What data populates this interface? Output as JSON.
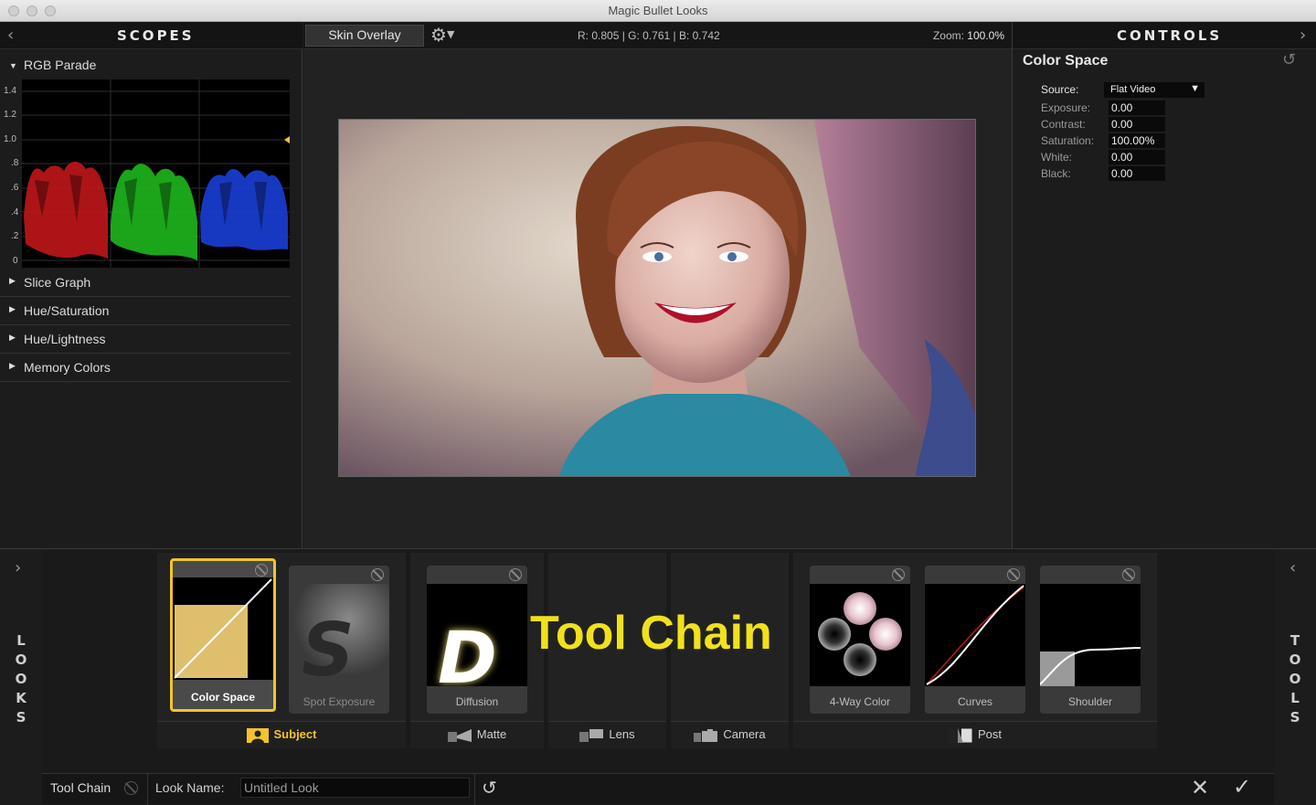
{
  "window": {
    "title": "Magic Bullet Looks"
  },
  "scopes": {
    "title": "SCOPES",
    "rgb_parade": {
      "label": "RGB Parade",
      "y_ticks": [
        "1.4",
        "1.2",
        "1.0",
        ".8",
        ".6",
        ".4",
        ".2",
        "0"
      ]
    },
    "sections": [
      "Slice Graph",
      "Hue/Saturation",
      "Hue/Lightness",
      "Memory Colors"
    ]
  },
  "viewer": {
    "skin_overlay_label": "Skin Overlay",
    "readout": "R: 0.805 | G: 0.761 | B: 0.742",
    "zoom_label": "Zoom:",
    "zoom_value": "100.0%"
  },
  "controls": {
    "title": "CONTROLS",
    "section_title": "Color Space",
    "source_label": "Source:",
    "source_value": "Flat Video",
    "params": [
      {
        "label": "Exposure:",
        "value": "0.00"
      },
      {
        "label": "Contrast:",
        "value": "0.00"
      },
      {
        "label": "Saturation:",
        "value": "100.00%"
      },
      {
        "label": "White:",
        "value": "0.00"
      },
      {
        "label": "Black:",
        "value": "0.00"
      }
    ]
  },
  "looks_side": [
    "L",
    "O",
    "O",
    "K",
    "S"
  ],
  "tools_side": [
    "T",
    "O",
    "O",
    "L",
    "S"
  ],
  "tool_chain": {
    "overlay_text": "Tool Chain",
    "categories": {
      "subject": "Subject",
      "matte": "Matte",
      "lens": "Lens",
      "camera": "Camera",
      "post": "Post"
    },
    "tools": {
      "color_space": "Color Space",
      "spot_exposure": "Spot Exposure",
      "diffusion": "Diffusion",
      "four_way": "4-Way Color",
      "curves": "Curves",
      "shoulder": "Shoulder"
    },
    "selected_tool": "Color Space",
    "accent_color": "#f2c42a",
    "overlay_color": "#f0e11c"
  },
  "status": {
    "tool_chain_label": "Tool Chain",
    "look_name_label": "Look Name:",
    "look_name_value": "Untitled Look"
  }
}
